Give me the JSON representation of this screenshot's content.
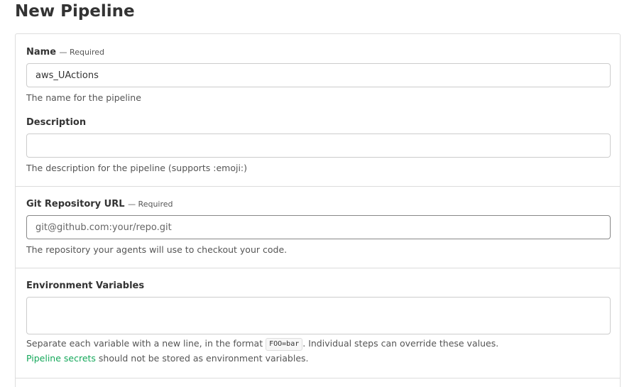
{
  "page": {
    "title": "New Pipeline"
  },
  "form": {
    "name": {
      "label": "Name",
      "required": "— Required",
      "value": "aws_UActions",
      "help": "The name for the pipeline"
    },
    "description": {
      "label": "Description",
      "value": "",
      "help": "The description for the pipeline (supports :emoji:)"
    },
    "repository": {
      "label": "Git Repository URL",
      "required": "— Required",
      "value": "",
      "placeholder": "git@github.com:your/repo.git",
      "help": "The repository your agents will use to checkout your code."
    },
    "env_vars": {
      "label": "Environment Variables",
      "value": "",
      "help_prefix": "Separate each variable with a new line, in the format",
      "help_code": "FOO=bar",
      "help_suffix": ". Individual steps can override these values.",
      "secrets_link": "Pipeline secrets",
      "secrets_suffix": " should not be stored as environment variables."
    }
  },
  "colors": {
    "link": "#14a85a",
    "border": "#dddddd",
    "text": "#333333",
    "muted": "#555555"
  }
}
